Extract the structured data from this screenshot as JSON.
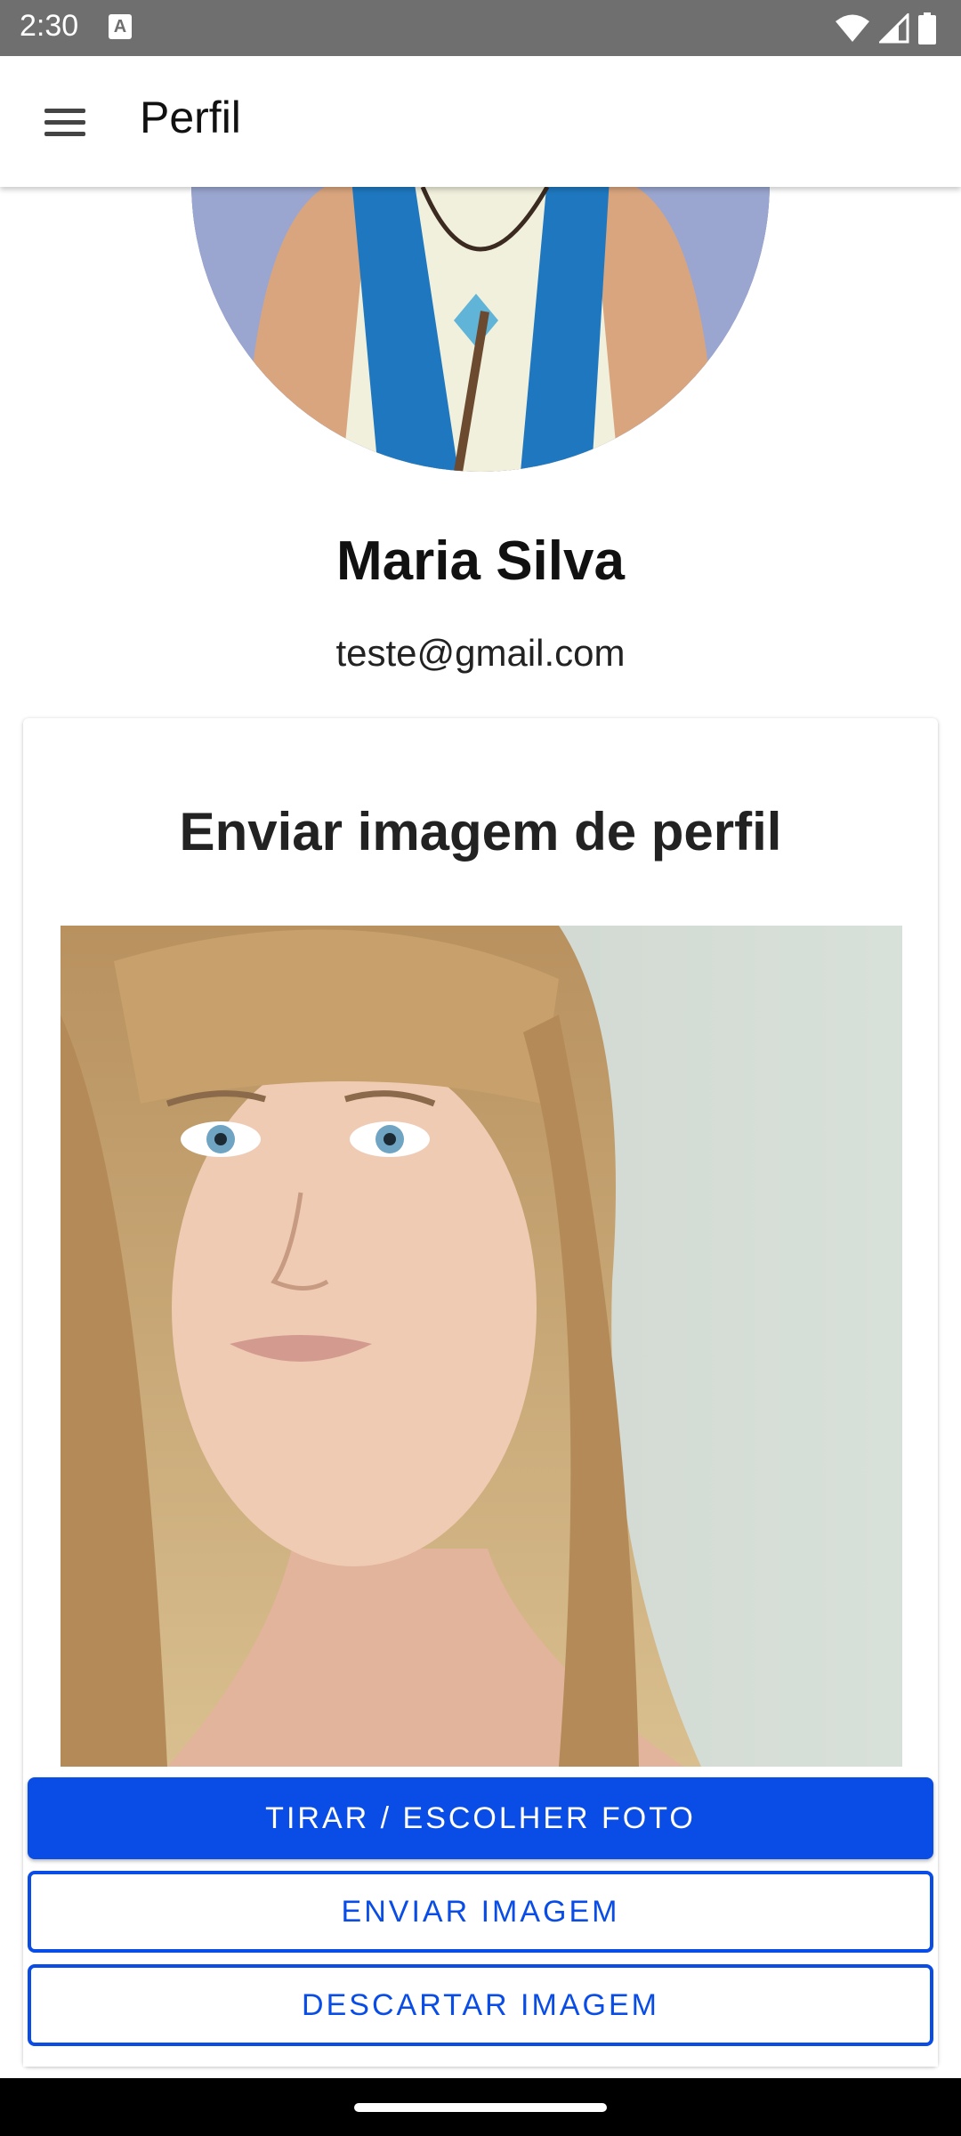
{
  "status_bar": {
    "time": "2:30",
    "notification_icon": "A",
    "icons": [
      "wifi-icon",
      "signal-icon",
      "battery-icon"
    ]
  },
  "app_bar": {
    "menu_icon": "hamburger-menu-icon",
    "title": "Perfil"
  },
  "profile": {
    "name": "Maria Silva",
    "email": "teste@gmail.com"
  },
  "upload_card": {
    "title": "Enviar imagem de perfil",
    "buttons": {
      "take_photo": "TIRAR / ESCOLHER FOTO",
      "send_image": "ENVIAR IMAGEM",
      "discard_image": "DESCARTAR IMAGEM"
    }
  },
  "colors": {
    "primary": "#0a4de6",
    "status_bar": "#6f6f6f",
    "nav_bar": "#000000"
  }
}
